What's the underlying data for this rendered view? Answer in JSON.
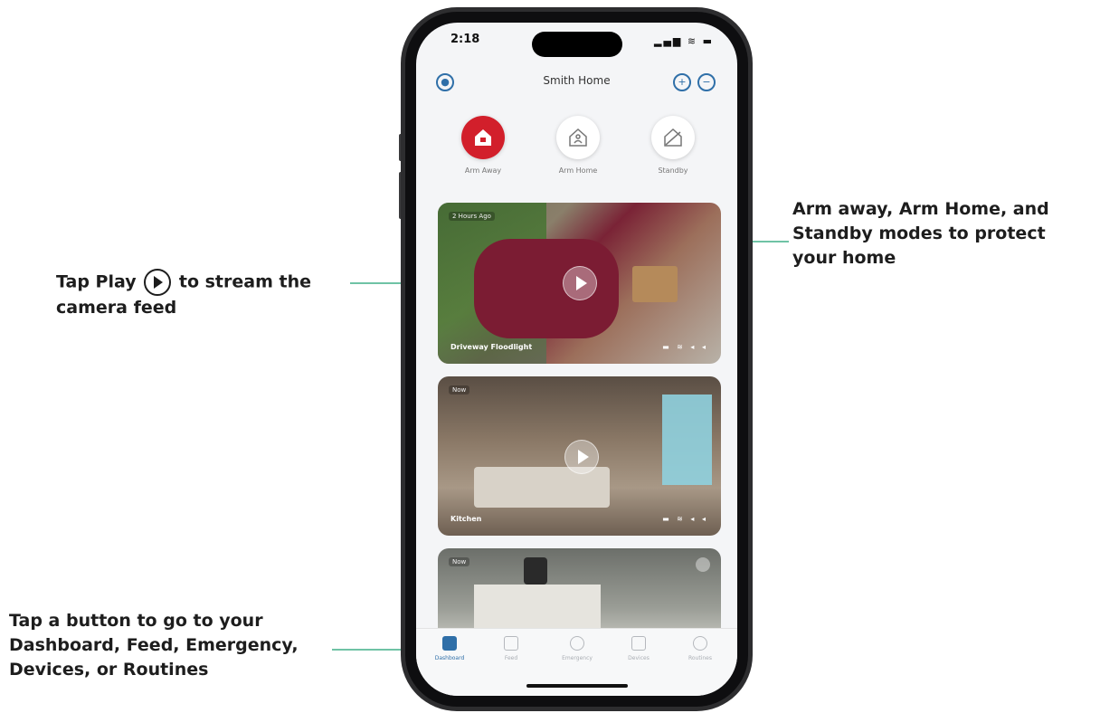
{
  "callouts": {
    "play_before": "Tap Play",
    "play_after": "to stream the",
    "play_line2": "camera feed",
    "modes_line1": "Arm away, Arm Home, and",
    "modes_line2": "Standby modes to protect",
    "modes_line3": "your home",
    "tabs_line1": "Tap a button to go to your",
    "tabs_line2": "Dashboard, Feed, Emergency,",
    "tabs_line3": "Devices, or Routines"
  },
  "status_bar": {
    "time": "2:18",
    "icons": "signal wifi battery"
  },
  "header": {
    "title": "Smith Home"
  },
  "modes": [
    {
      "label": "Arm Away",
      "active": true
    },
    {
      "label": "Arm Home",
      "active": false
    },
    {
      "label": "Standby",
      "active": false
    }
  ],
  "cameras": [
    {
      "name": "Driveway Floodlight",
      "tag": "2 Hours Ago"
    },
    {
      "name": "Kitchen",
      "tag": "Now"
    },
    {
      "name": "",
      "tag": "Now"
    }
  ],
  "tabs": [
    {
      "label": "Dashboard",
      "active": true
    },
    {
      "label": "Feed",
      "active": false
    },
    {
      "label": "Emergency",
      "active": false
    },
    {
      "label": "Devices",
      "active": false
    },
    {
      "label": "Routines",
      "active": false
    }
  ],
  "colors": {
    "accent_red": "#d21f2b",
    "accent_blue": "#2f6fa8",
    "callout_line": "#6fc3a5"
  }
}
